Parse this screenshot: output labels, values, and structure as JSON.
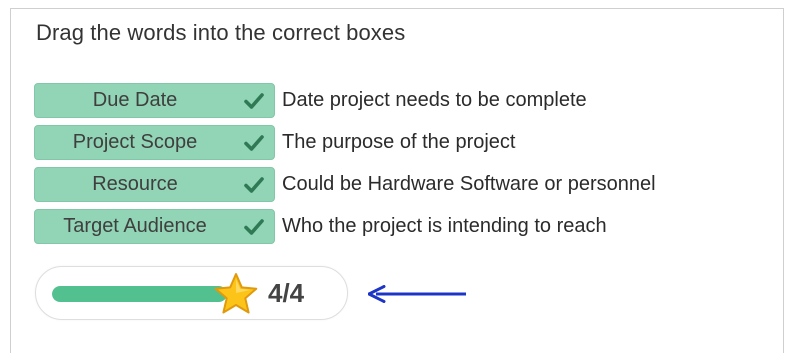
{
  "instructions": "Drag the words into the correct boxes",
  "items": [
    {
      "label": "Due Date",
      "definition": "Date project needs to be complete",
      "correct": true
    },
    {
      "label": "Project Scope",
      "definition": "The purpose of the project",
      "correct": true
    },
    {
      "label": "Resource",
      "definition": "Could be Hardware Software or personnel",
      "correct": true
    },
    {
      "label": "Target Audience",
      "definition": "Who the project is intending to reach",
      "correct": true
    }
  ],
  "score": {
    "text": "4/4",
    "progress": 1.0
  },
  "colors": {
    "chip_bg": "#92d4b6",
    "check": "#2f7a55",
    "progress_fill": "#53c08f",
    "star": "#fcc419",
    "arrow": "#1c35c7"
  },
  "icons": {
    "check": "check-icon",
    "star": "star-icon",
    "arrow": "arrow-left-icon"
  }
}
